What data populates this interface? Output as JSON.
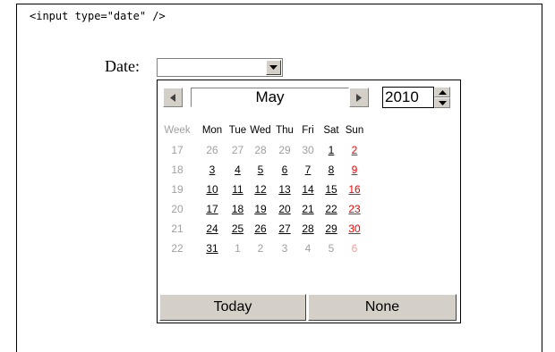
{
  "code_snippet": "<input type=\"date\" />",
  "field": {
    "label": "Date:",
    "value": ""
  },
  "calendar": {
    "month": "May",
    "year": "2010",
    "week_header": "Week",
    "day_headers": [
      "Mon",
      "Tue",
      "Wed",
      "Thu",
      "Fri",
      "Sat",
      "Sun"
    ],
    "weeks": [
      {
        "week": "17",
        "days": [
          {
            "d": "26",
            "in": false
          },
          {
            "d": "27",
            "in": false
          },
          {
            "d": "28",
            "in": false
          },
          {
            "d": "29",
            "in": false
          },
          {
            "d": "30",
            "in": false
          },
          {
            "d": "1",
            "in": true
          },
          {
            "d": "2",
            "in": true
          }
        ]
      },
      {
        "week": "18",
        "days": [
          {
            "d": "3",
            "in": true
          },
          {
            "d": "4",
            "in": true
          },
          {
            "d": "5",
            "in": true
          },
          {
            "d": "6",
            "in": true
          },
          {
            "d": "7",
            "in": true
          },
          {
            "d": "8",
            "in": true
          },
          {
            "d": "9",
            "in": true
          }
        ]
      },
      {
        "week": "19",
        "days": [
          {
            "d": "10",
            "in": true
          },
          {
            "d": "11",
            "in": true
          },
          {
            "d": "12",
            "in": true
          },
          {
            "d": "13",
            "in": true
          },
          {
            "d": "14",
            "in": true
          },
          {
            "d": "15",
            "in": true
          },
          {
            "d": "16",
            "in": true
          }
        ]
      },
      {
        "week": "20",
        "days": [
          {
            "d": "17",
            "in": true
          },
          {
            "d": "18",
            "in": true
          },
          {
            "d": "19",
            "in": true
          },
          {
            "d": "20",
            "in": true
          },
          {
            "d": "21",
            "in": true
          },
          {
            "d": "22",
            "in": true
          },
          {
            "d": "23",
            "in": true
          }
        ]
      },
      {
        "week": "21",
        "days": [
          {
            "d": "24",
            "in": true
          },
          {
            "d": "25",
            "in": true
          },
          {
            "d": "26",
            "in": true
          },
          {
            "d": "27",
            "in": true
          },
          {
            "d": "28",
            "in": true
          },
          {
            "d": "29",
            "in": true
          },
          {
            "d": "30",
            "in": true
          }
        ]
      },
      {
        "week": "22",
        "days": [
          {
            "d": "31",
            "in": true
          },
          {
            "d": "1",
            "in": false
          },
          {
            "d": "2",
            "in": false
          },
          {
            "d": "3",
            "in": false
          },
          {
            "d": "4",
            "in": false
          },
          {
            "d": "5",
            "in": false
          },
          {
            "d": "6",
            "in": false
          }
        ]
      }
    ],
    "today_label": "Today",
    "none_label": "None"
  },
  "colors": {
    "button_face": "#d4d0c8",
    "sunday": "#ff0000",
    "sunday_dim": "#ff9a9a",
    "dim": "#a0a0a0"
  },
  "icons": {
    "prev": "left-triangle-icon",
    "next": "right-triangle-icon",
    "dropdown": "down-triangle-icon",
    "spin_up": "up-triangle-icon",
    "spin_down": "down-triangle-icon"
  }
}
